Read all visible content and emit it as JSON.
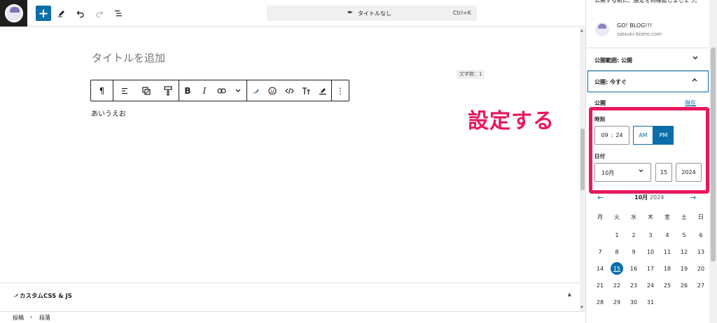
{
  "toolbar": {
    "add_icon": "+",
    "command": {
      "title": "タイトルなし",
      "shortcut": "Ctrl+K"
    }
  },
  "editor": {
    "title_placeholder": "タイトルを追加",
    "char_count": "文字数：1",
    "paragraph_text": "あいうえお"
  },
  "block_toolbar": {
    "bold": "B",
    "italic": "I"
  },
  "metabox": {
    "title": "カスタムCSS & JS",
    "toggle": "▲"
  },
  "breadcrumb": [
    "投稿",
    "段落"
  ],
  "breadcrumb_separator": "›",
  "sidebar": {
    "notice": "公開する前に、設定を再確認しましょう。",
    "author_name": "GO! BLOG!!!",
    "author_site": "satsuki-bistro.com",
    "visibility_label": "公開範囲: 公開",
    "publish_label": "公開: 今すぐ",
    "publish_heading": "公開",
    "now_link": "現在",
    "time_label": "時刻",
    "hour": "09",
    "minute": "24",
    "am": "AM",
    "pm": "PM",
    "date_label": "日付",
    "month": "10月",
    "day": "15",
    "year": "2024",
    "calendar": {
      "month": "10月",
      "year": "2024",
      "weekdays": [
        "月",
        "火",
        "水",
        "木",
        "金",
        "土",
        "日"
      ],
      "selected_day": 15,
      "days": [
        1,
        2,
        3,
        4,
        5,
        6,
        7,
        8,
        9,
        10,
        11,
        12,
        13,
        14,
        15,
        16,
        17,
        18,
        19,
        20,
        21,
        22,
        23,
        24,
        25,
        26,
        27,
        28,
        29,
        30,
        31
      ],
      "first_weekday_index": 1
    }
  },
  "annotation": "設定する",
  "colors": {
    "accent": "#0a6ea8",
    "highlight": "#e8185e"
  }
}
